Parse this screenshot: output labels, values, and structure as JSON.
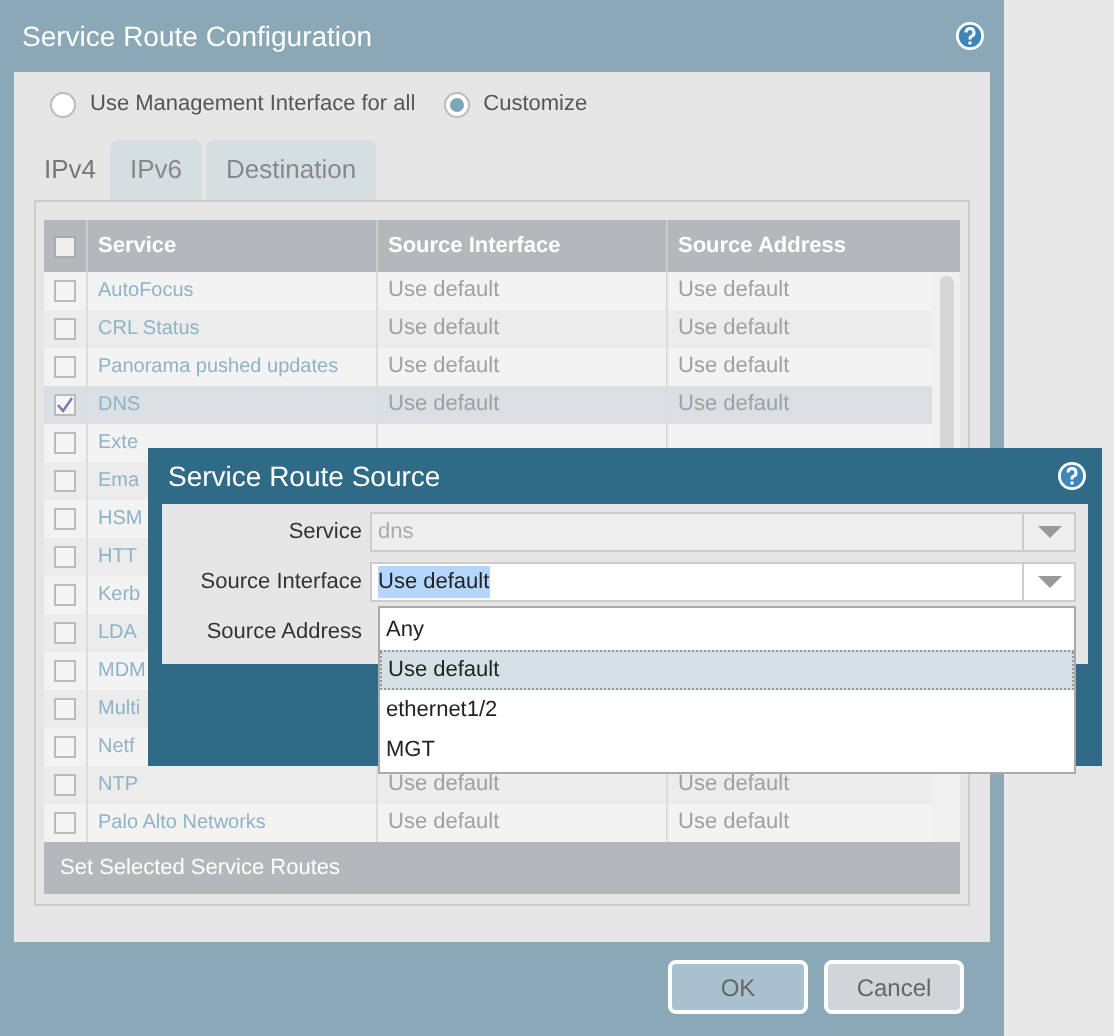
{
  "window": {
    "title": "Service Route Configuration"
  },
  "mode_options": [
    {
      "label": "Use Management Interface for all",
      "selected": false
    },
    {
      "label": "Customize",
      "selected": true
    }
  ],
  "tabs": [
    {
      "label": "IPv4",
      "selected": true
    },
    {
      "label": "IPv6",
      "selected": false
    },
    {
      "label": "Destination",
      "selected": false
    }
  ],
  "table": {
    "columns": [
      "Service",
      "Source Interface",
      "Source Address"
    ],
    "rows": [
      {
        "service": "AutoFocus",
        "source_interface": "Use default",
        "source_address": "Use default",
        "checked": false,
        "selected": false
      },
      {
        "service": "CRL Status",
        "source_interface": "Use default",
        "source_address": "Use default",
        "checked": false,
        "selected": false
      },
      {
        "service": "Panorama pushed updates",
        "source_interface": "Use default",
        "source_address": "Use default",
        "checked": false,
        "selected": false
      },
      {
        "service": "DNS",
        "source_interface": "Use default",
        "source_address": "Use default",
        "checked": true,
        "selected": true
      },
      {
        "service": "Exte",
        "checked": false,
        "selected": false
      },
      {
        "service": "Ema",
        "checked": false,
        "selected": false
      },
      {
        "service": "HSM",
        "checked": false,
        "selected": false
      },
      {
        "service": "HTT",
        "checked": false,
        "selected": false
      },
      {
        "service": "Kerb",
        "checked": false,
        "selected": false
      },
      {
        "service": "LDA",
        "checked": false,
        "selected": false
      },
      {
        "service": "MDM",
        "checked": false,
        "selected": false
      },
      {
        "service": "Multi",
        "checked": false,
        "selected": false
      },
      {
        "service": "Netf",
        "checked": false,
        "selected": false
      },
      {
        "service": "NTP",
        "source_interface": "Use default",
        "source_address": "Use default",
        "checked": false,
        "selected": false
      },
      {
        "service": "Palo Alto Networks",
        "source_interface": "Use default",
        "source_address": "Use default",
        "checked": false,
        "selected": false
      }
    ],
    "footer": "Set Selected Service Routes",
    "select_all_checked": false
  },
  "buttons": [
    "OK",
    "Cancel"
  ],
  "modal": {
    "title": "Service Route Source",
    "fields": [
      {
        "label": "Service",
        "value": "dns",
        "disabled": true
      },
      {
        "label": "Source Interface",
        "value": "Use default",
        "disabled": false
      },
      {
        "label": "Source Address"
      }
    ],
    "dropdown_options": [
      {
        "label": "Any",
        "selected": false
      },
      {
        "label": "Use default",
        "selected": true
      },
      {
        "label": "ethernet1/2",
        "selected": false
      },
      {
        "label": "MGT",
        "selected": false
      }
    ]
  }
}
